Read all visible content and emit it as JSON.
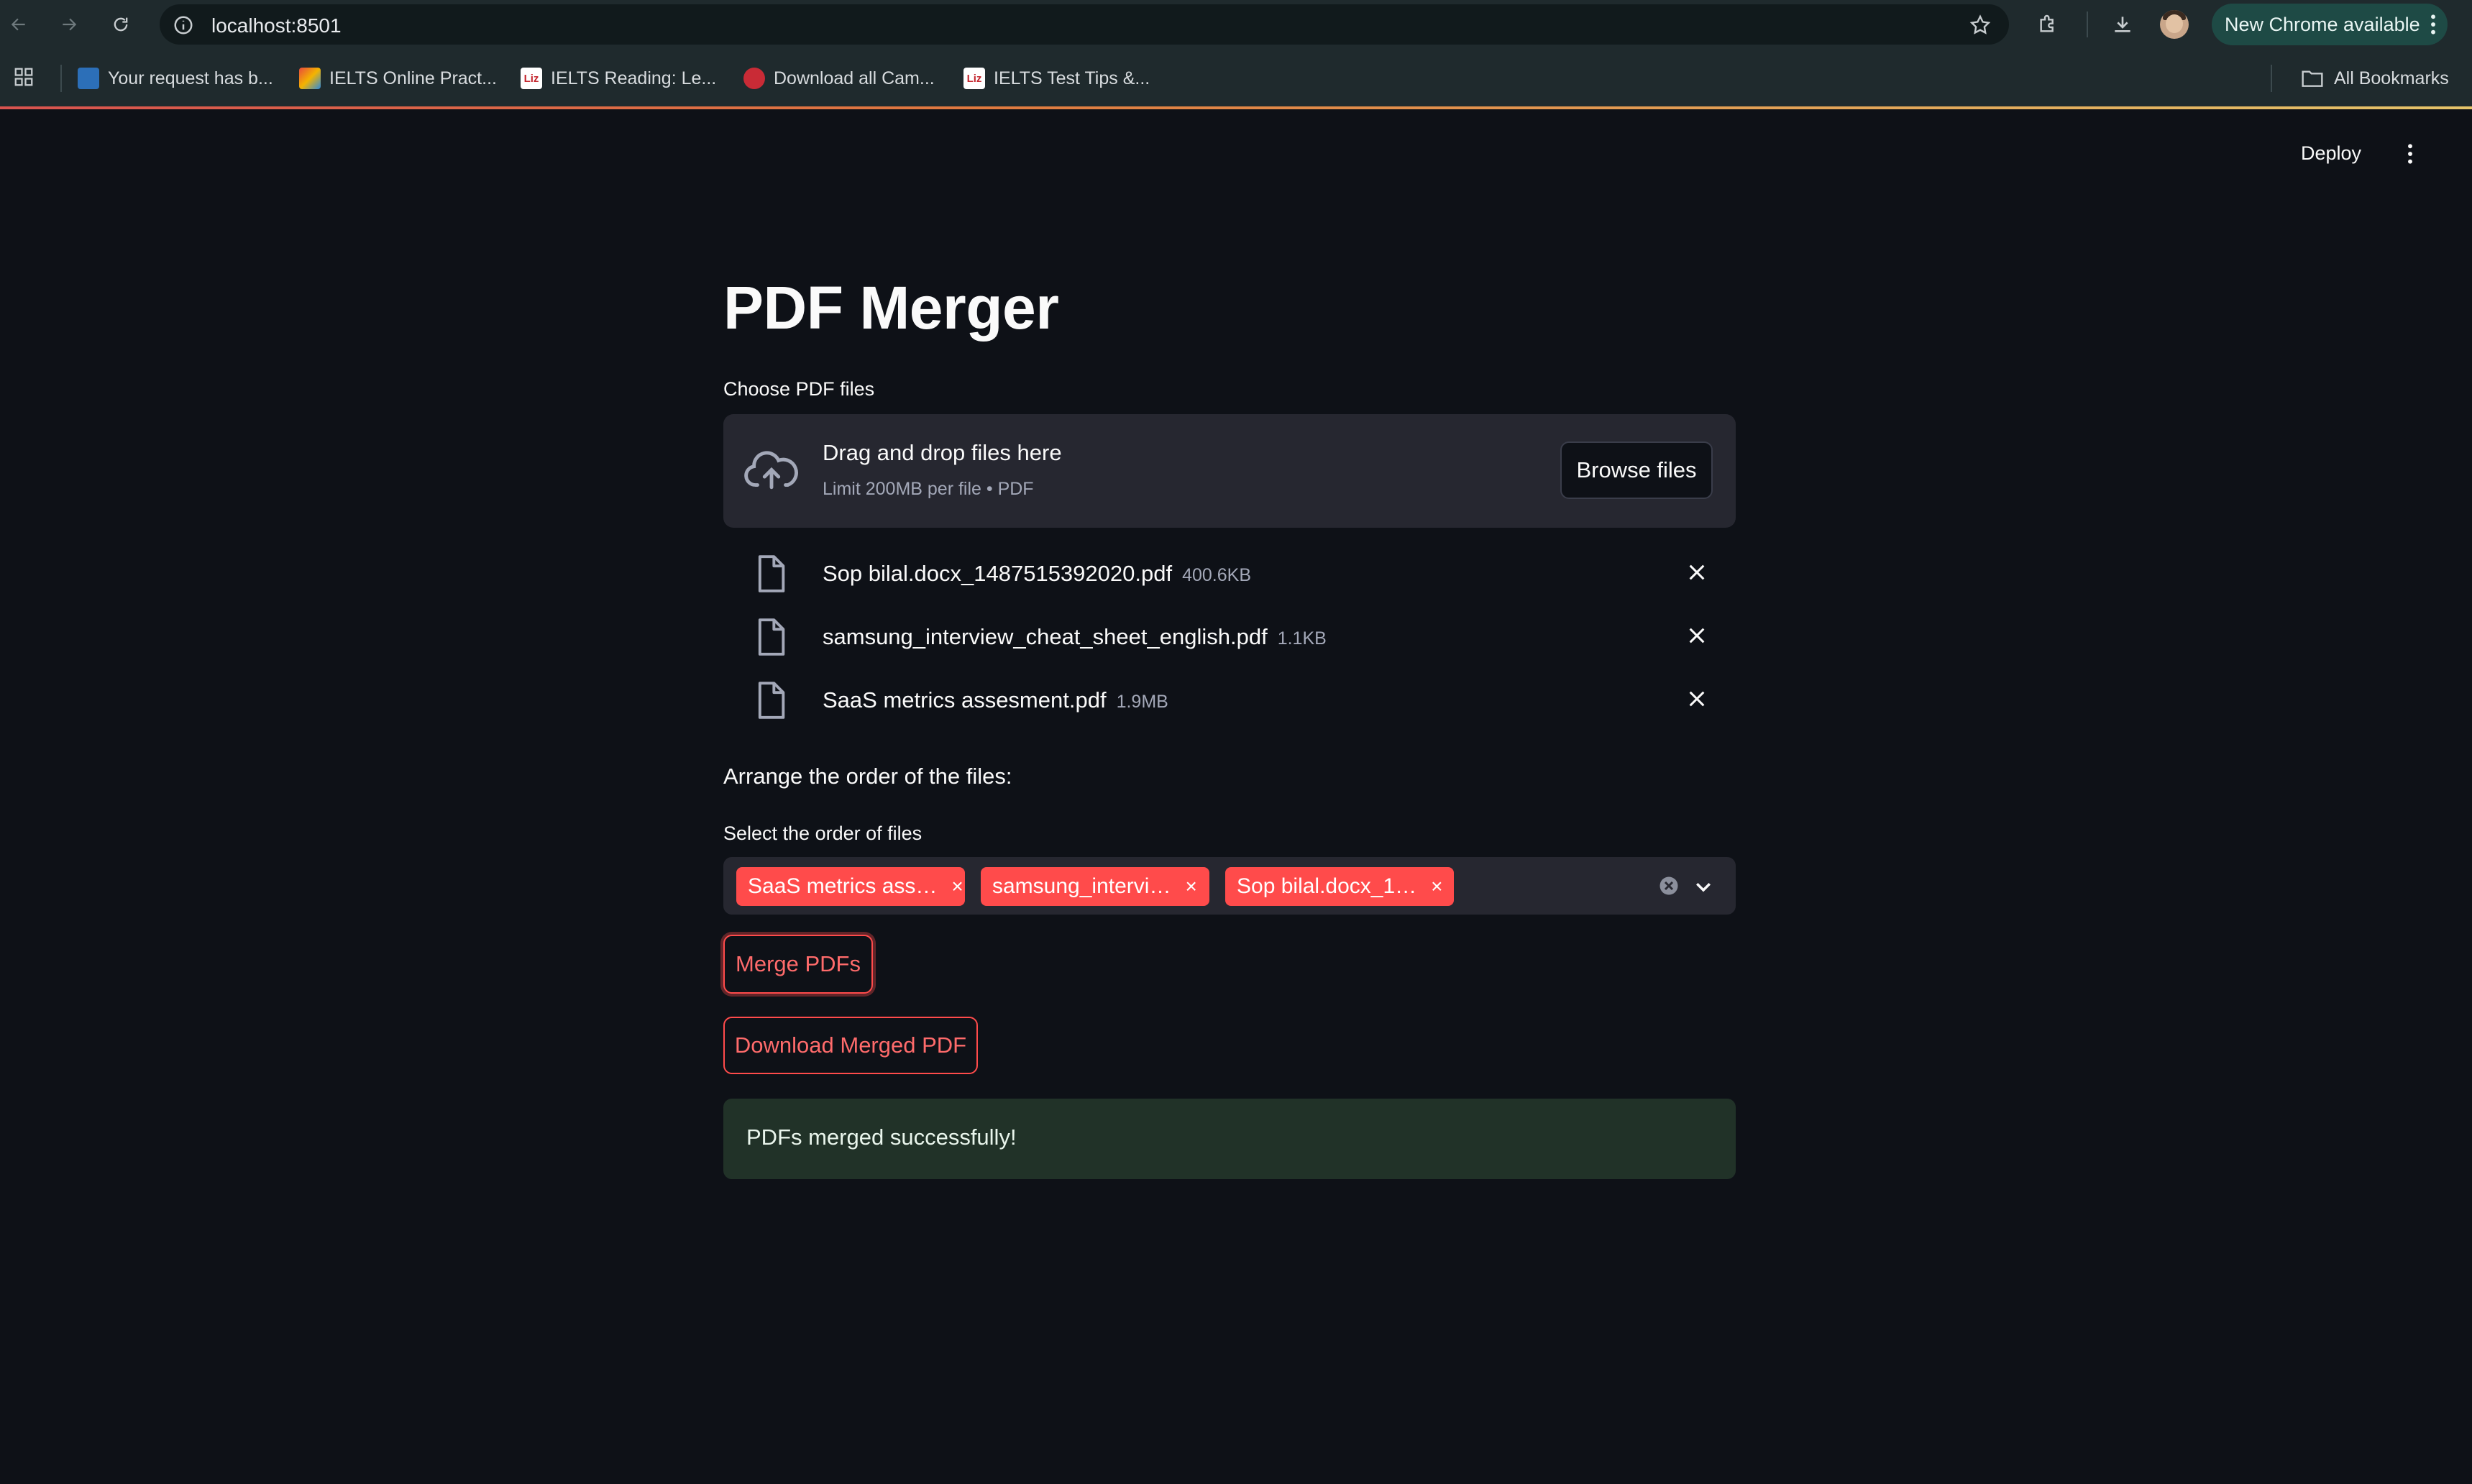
{
  "browser": {
    "url": "localhost:8501",
    "update_label": "New Chrome available",
    "bookmarks": [
      {
        "label": "Your request has b...",
        "icon": "globe-favicon"
      },
      {
        "label": "IELTS Online Pract...",
        "icon": "ielts-favicon"
      },
      {
        "label": "IELTS Reading: Le...",
        "icon": "liz-favicon"
      },
      {
        "label": "Download all Cam...",
        "icon": "red-favicon"
      },
      {
        "label": "IELTS Test Tips &...",
        "icon": "liz-favicon"
      }
    ],
    "all_bookmarks_label": "All Bookmarks",
    "liz_fav_text": "Liz"
  },
  "app": {
    "deploy_label": "Deploy",
    "title": "PDF Merger",
    "uploader": {
      "label": "Choose PDF files",
      "drop_title": "Drag and drop files here",
      "drop_sub": "Limit 200MB per file • PDF",
      "browse_label": "Browse files"
    },
    "files": [
      {
        "name": "Sop bilal.docx_1487515392020.pdf",
        "size": "400.6KB"
      },
      {
        "name": "samsung_interview_cheat_sheet_english.pdf",
        "size": "1.1KB"
      },
      {
        "name": "SaaS metrics assesment.pdf",
        "size": "1.9MB"
      }
    ],
    "arrange_text": "Arrange the order of the files:",
    "select": {
      "label": "Select the order of files",
      "chips": [
        "SaaS metrics ass…",
        "samsung_intervi…",
        "Sop bilal.docx_1…"
      ]
    },
    "merge_label": "Merge PDFs",
    "download_label": "Download Merged PDF",
    "success_message": "PDFs merged successfully!"
  },
  "colors": {
    "background": "#0e1117",
    "primary": "#ff4b4b",
    "surface": "#262730",
    "success_bg": "#213228"
  }
}
